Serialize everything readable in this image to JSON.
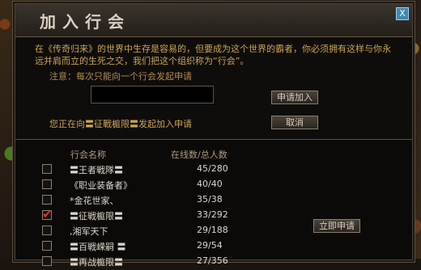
{
  "dialog": {
    "title": "加入行会",
    "close_label": "X"
  },
  "intro": {
    "text": "在《传奇归来》的世界中生存是容易的，但要成为这个世界的霸者，你必须拥有这样与你永远并肩而立的生死之交，我们把这个组织称为“行会”。",
    "note": "注意：每次只能向一个行会发起申请"
  },
  "apply": {
    "input_value": "",
    "apply_label": "申请加入",
    "cancel_label": "取消",
    "status_text": "您正在向〓征戰榳限〓发起加入申请"
  },
  "list": {
    "header_name": "行会名称",
    "header_count": "在线数/总人数",
    "join_now_label": "立即申请",
    "rows": [
      {
        "name": "〓王者戦隊〓",
        "count": "45/280",
        "checked": false
      },
      {
        "name": "《职业装备者》",
        "count": "40/40",
        "checked": false
      },
      {
        "name": "*金花世家、",
        "count": "35/38",
        "checked": false
      },
      {
        "name": "〓征戦榳限〓",
        "count": "33/292",
        "checked": true
      },
      {
        "name": ",湘军天下",
        "count": "29/188",
        "checked": false
      },
      {
        "name": "〓百戦嵘嗣 〓",
        "count": "29/54",
        "checked": false
      },
      {
        "name": "〓再战榳限〓",
        "count": "27/356",
        "checked": false
      }
    ]
  }
}
